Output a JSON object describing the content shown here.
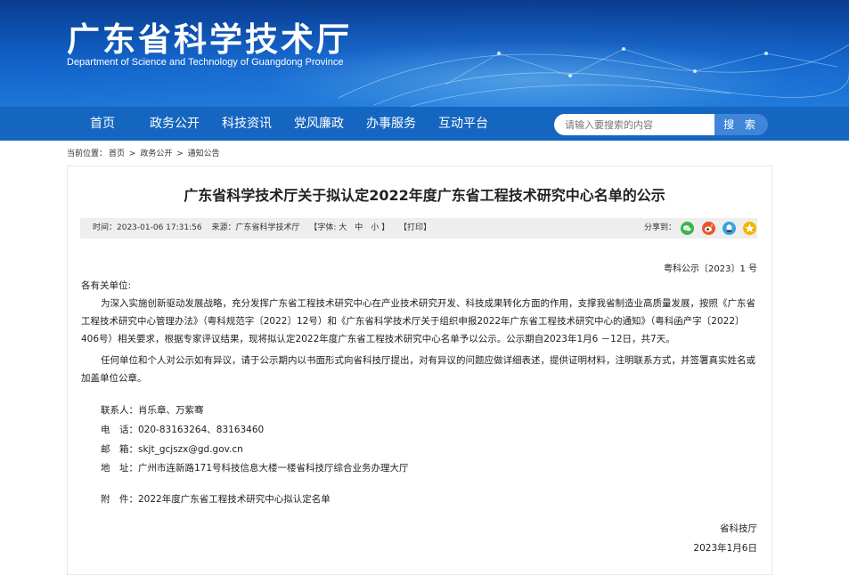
{
  "header": {
    "title": "广东省科学技术厅",
    "subtitle": "Department of Science and Technology of Guangdong Province"
  },
  "nav": {
    "items": [
      "首页",
      "政务公开",
      "科技资讯",
      "党风廉政",
      "办事服务",
      "互动平台"
    ],
    "search_placeholder": "请输入要搜索的内容",
    "search_button": "搜 索"
  },
  "breadcrumb": {
    "label": "当前位置：",
    "items": [
      "首页",
      ">",
      "政务公开",
      ">",
      "通知公告"
    ]
  },
  "article": {
    "title": "广东省科学技术厅关于拟认定2022年度广东省工程技术研究中心名单的公示",
    "meta": {
      "time": "时间：2023-01-06 17:31:56",
      "source": "来源：广东省科学技术厅",
      "font": "【字体: 大　中　小 】",
      "print": "【打印】",
      "share_label": "分享到："
    },
    "doc_no": "粤科公示〔2023〕1 号",
    "salutation": "各有关单位:",
    "paragraphs": [
      "为深入实施创新驱动发展战略，充分发挥广东省工程技术研究中心在产业技术研究开发、科技成果转化方面的作用，支撑我省制造业高质量发展，按照《广东省工程技术研究中心管理办法》（粤科规范字〔2022〕12号）和《广东省科学技术厅关于组织申报2022年广东省工程技术研究中心的通知》（粤科函产字〔2022〕406号）相关要求，根据专家评议结果，现将拟认定2022年度广东省工程技术研究中心名单予以公示。公示期自2023年1月6 －12日，共7天。",
      "任何单位和个人对公示如有异议，请于公示期内以书面形式向省科技厅提出，对有异议的问题应做详细表述，提供证明材料，注明联系方式，并签署真实姓名或加盖单位公章。"
    ],
    "contacts": [
      {
        "label": "联系人：",
        "value": "肖乐章、万紫骞"
      },
      {
        "label": "电　话：",
        "value": "020-83163264、83163460"
      },
      {
        "label": "邮　箱：",
        "value": "skjt_gcjszx@gd.gov.cn"
      },
      {
        "label": "地　址：",
        "value": "广州市连新路171号科技信息大楼一楼省科技厅综合业务办理大厅"
      }
    ],
    "attachment": {
      "label": "附　件：",
      "value": "2022年度广东省工程技术研究中心拟认定名单"
    },
    "signature": "省科技厅",
    "date": "2023年1月6日"
  },
  "colors": {
    "nav_bg": "#1566c0",
    "search_button": "#3f86d8",
    "share_wechat": "#3ab54a",
    "share_weibo": "#e8562a",
    "share_qq": "#3aa0e0",
    "share_qzone": "#f5b400"
  },
  "share_icons": [
    "wechat-icon",
    "weibo-icon",
    "qq-icon",
    "qzone-icon"
  ]
}
